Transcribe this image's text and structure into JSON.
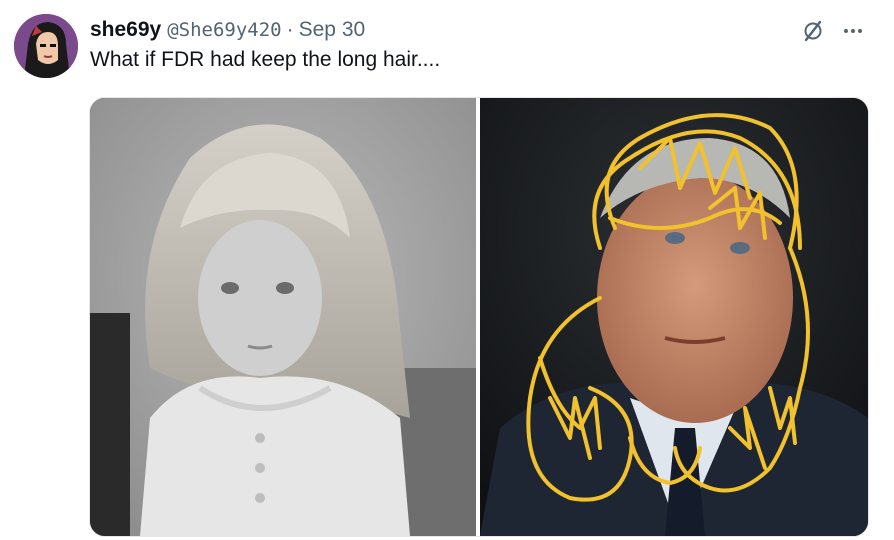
{
  "tweet": {
    "display_name": "she69y",
    "handle": "@She69y420",
    "separator": "·",
    "date": "Sep 30",
    "text": "What if FDR had keep the long hair...."
  },
  "icons": {
    "avatar": "avatar-illustration",
    "grok": "grok-icon",
    "more": "more-icon"
  },
  "media": {
    "images": [
      {
        "name": "photo-child-long-hair",
        "desc_visible": false
      },
      {
        "name": "photo-fdr-with-drawn-hair",
        "desc_visible": false
      }
    ],
    "drawing_color": "#f2c12e"
  },
  "colors": {
    "text": "#0f1419",
    "secondary": "#536471"
  }
}
